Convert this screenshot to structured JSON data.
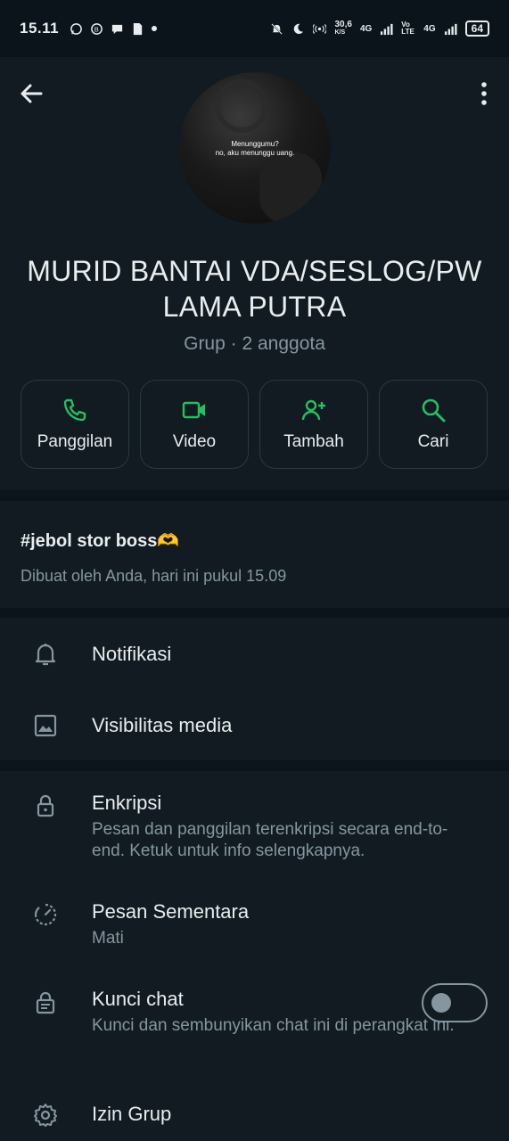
{
  "status_bar": {
    "time": "15.11",
    "network_speed": "30,6",
    "network_unit": "K/S",
    "sim1": "4G",
    "sim2_volte": "Vo LTE",
    "sim2": "4G",
    "battery": "64"
  },
  "header": {
    "avatar_caption_line1": "Menunggumu?",
    "avatar_caption_line2": "no, aku menunggu uang.",
    "group_name": "MURID BANTAI VDA/SESLOG/PW LAMA PUTRA",
    "subtitle": "Grup · 2 anggota"
  },
  "actions": [
    {
      "label": "Panggilan",
      "icon": "phone-icon"
    },
    {
      "label": "Video",
      "icon": "video-icon"
    },
    {
      "label": "Tambah",
      "icon": "add-person-icon"
    },
    {
      "label": "Cari",
      "icon": "search-icon"
    }
  ],
  "description": {
    "title": "#jebol stor boss",
    "emoji": "🫶",
    "created": "Dibuat oleh Anda, hari ini pukul 15.09"
  },
  "settings": {
    "notifications": {
      "title": "Notifikasi"
    },
    "media_visibility": {
      "title": "Visibilitas media"
    },
    "encryption": {
      "title": "Enkripsi",
      "subtitle": "Pesan dan panggilan terenkripsi secara end-to-end. Ketuk untuk info selengkapnya."
    },
    "disappearing": {
      "title": "Pesan Sementara",
      "subtitle": "Mati"
    },
    "chat_lock": {
      "title": "Kunci chat",
      "subtitle": "Kunci dan sembunyikan chat ini di perangkat ini.",
      "enabled": false
    },
    "group_permissions": {
      "title": "Izin Grup"
    }
  },
  "colors": {
    "accent": "#21c063",
    "background": "#111b21",
    "separator": "#0b141a",
    "secondary_text": "#8696a0"
  }
}
